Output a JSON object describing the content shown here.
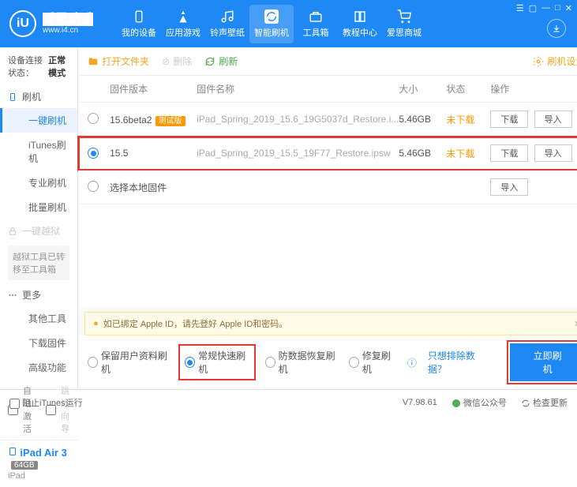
{
  "header": {
    "logo_char": "iU",
    "title": "爱思助手",
    "site": "www.i4.cn",
    "nav": [
      "我的设备",
      "应用游戏",
      "铃声壁纸",
      "智能刷机",
      "工具箱",
      "教程中心",
      "爱思商城"
    ]
  },
  "sidebar": {
    "status_label": "设备连接状态：",
    "status_value": "正常模式",
    "group_flash": "刷机",
    "items_flash": [
      "一键刷机",
      "iTunes刷机",
      "专业刷机",
      "批量刷机"
    ],
    "group_jailbreak": "一键越狱",
    "jb_note": "越狱工具已转移至工具箱",
    "group_more": "更多",
    "items_more": [
      "其他工具",
      "下载固件",
      "高级功能"
    ],
    "auto_activate": "自动激活",
    "skip_guide": "跳过向导",
    "device_name": "iPad Air 3",
    "device_storage": "64GB",
    "device_type": "iPad"
  },
  "toolbar": {
    "open_folder": "打开文件夹",
    "delete": "删除",
    "refresh": "刷新",
    "settings": "刷机设置"
  },
  "table": {
    "headers": [
      "固件版本",
      "固件名称",
      "大小",
      "状态",
      "操作"
    ],
    "rows": [
      {
        "version": "15.6beta2",
        "beta": "测试版",
        "name": "iPad_Spring_2019_15.6_19G5037d_Restore.i...",
        "size": "5.46GB",
        "status": "未下载",
        "selected": false
      },
      {
        "version": "15.5",
        "beta": "",
        "name": "iPad_Spring_2019_15.5_19F77_Restore.ipsw",
        "size": "5.46GB",
        "status": "未下载",
        "selected": true
      }
    ],
    "local_fw": "选择本地固件",
    "btn_download": "下载",
    "btn_import": "导入"
  },
  "alert": "如已绑定 Apple ID，请先登好 Apple ID和密码。",
  "modes": {
    "keep_data": "保留用户资料刷机",
    "normal": "常规快速刷机",
    "antirecovery": "防数据恢复刷机",
    "repair": "修复刷机",
    "exclude_link": "只想排除数据？",
    "flash_btn": "立即刷机"
  },
  "footer": {
    "block_itunes": "阻止iTunes运行",
    "version": "V7.98.61",
    "wechat": "微信公众号",
    "check_update": "检查更新"
  }
}
